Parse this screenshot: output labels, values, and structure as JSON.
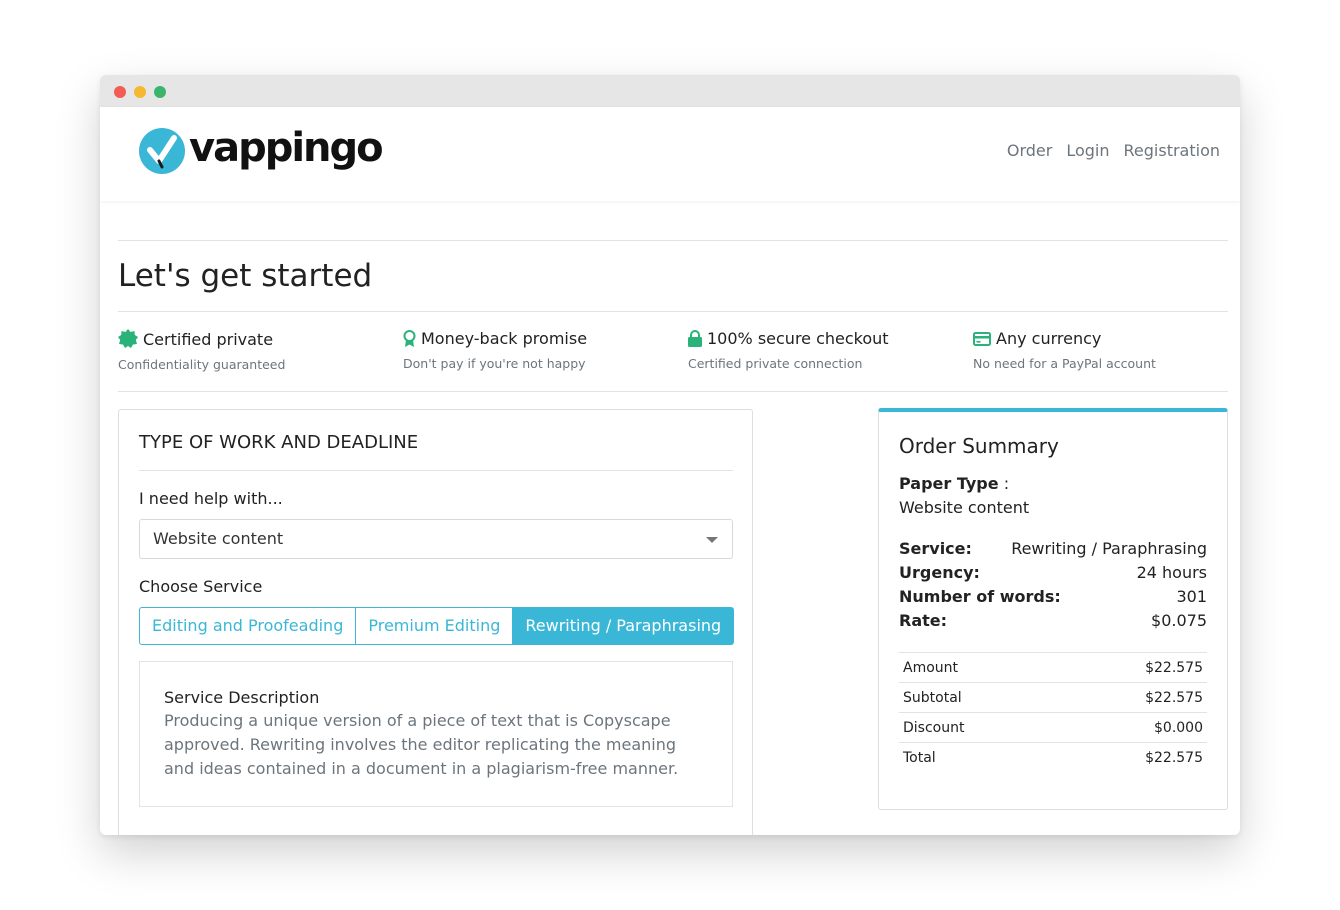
{
  "colors": {
    "accent": "#3ab7d6",
    "icon_green": "#2ab27b",
    "muted": "#6c757d"
  },
  "brand": {
    "name": "vappingo",
    "logo_icon": "checkmark-badge-icon"
  },
  "nav": {
    "items": [
      "Order",
      "Login",
      "Registration"
    ]
  },
  "page": {
    "title": "Let's get started"
  },
  "features": [
    {
      "icon": "certified-badge-icon",
      "title": "Certified private",
      "subtitle": "Confidentiality guaranteed"
    },
    {
      "icon": "award-ribbon-icon",
      "title": "Money-back promise",
      "subtitle": "Don't pay if you're not happy"
    },
    {
      "icon": "lock-icon",
      "title": "100% secure checkout",
      "subtitle": "Certified private connection"
    },
    {
      "icon": "credit-card-icon",
      "title": "Any currency",
      "subtitle": "No need for a PayPal account"
    }
  ],
  "form": {
    "heading": "TYPE OF WORK AND DEADLINE",
    "help_label": "I need help with...",
    "help_value": "Website content",
    "service_label": "Choose Service",
    "services": [
      "Editing and Proofeading",
      "Premium Editing",
      "Rewriting / Paraphrasing"
    ],
    "active_service": "Rewriting / Paraphrasing",
    "description": {
      "title": "Service Description",
      "text": "Producing a unique version of a piece of text that is Copyscape approved. Rewriting involves the editor replicating the meaning and ideas contained in a document in a plagiarism-free manner."
    }
  },
  "summary": {
    "title": "Order Summary",
    "paper_type_label": "Paper Type",
    "paper_type_sep": " :",
    "paper_type_value": "Website content",
    "details": [
      {
        "label": "Service:",
        "value": "Rewriting / Paraphrasing"
      },
      {
        "label": "Urgency:",
        "value": "24 hours"
      },
      {
        "label": "Number of words:",
        "value": "301"
      },
      {
        "label": "Rate:",
        "value": "$0.075"
      }
    ],
    "totals": [
      {
        "label": "Amount",
        "value": "$22.575"
      },
      {
        "label": "Subtotal",
        "value": "$22.575"
      },
      {
        "label": "Discount",
        "value": "$0.000"
      },
      {
        "label": "Total",
        "value": "$22.575"
      }
    ]
  }
}
